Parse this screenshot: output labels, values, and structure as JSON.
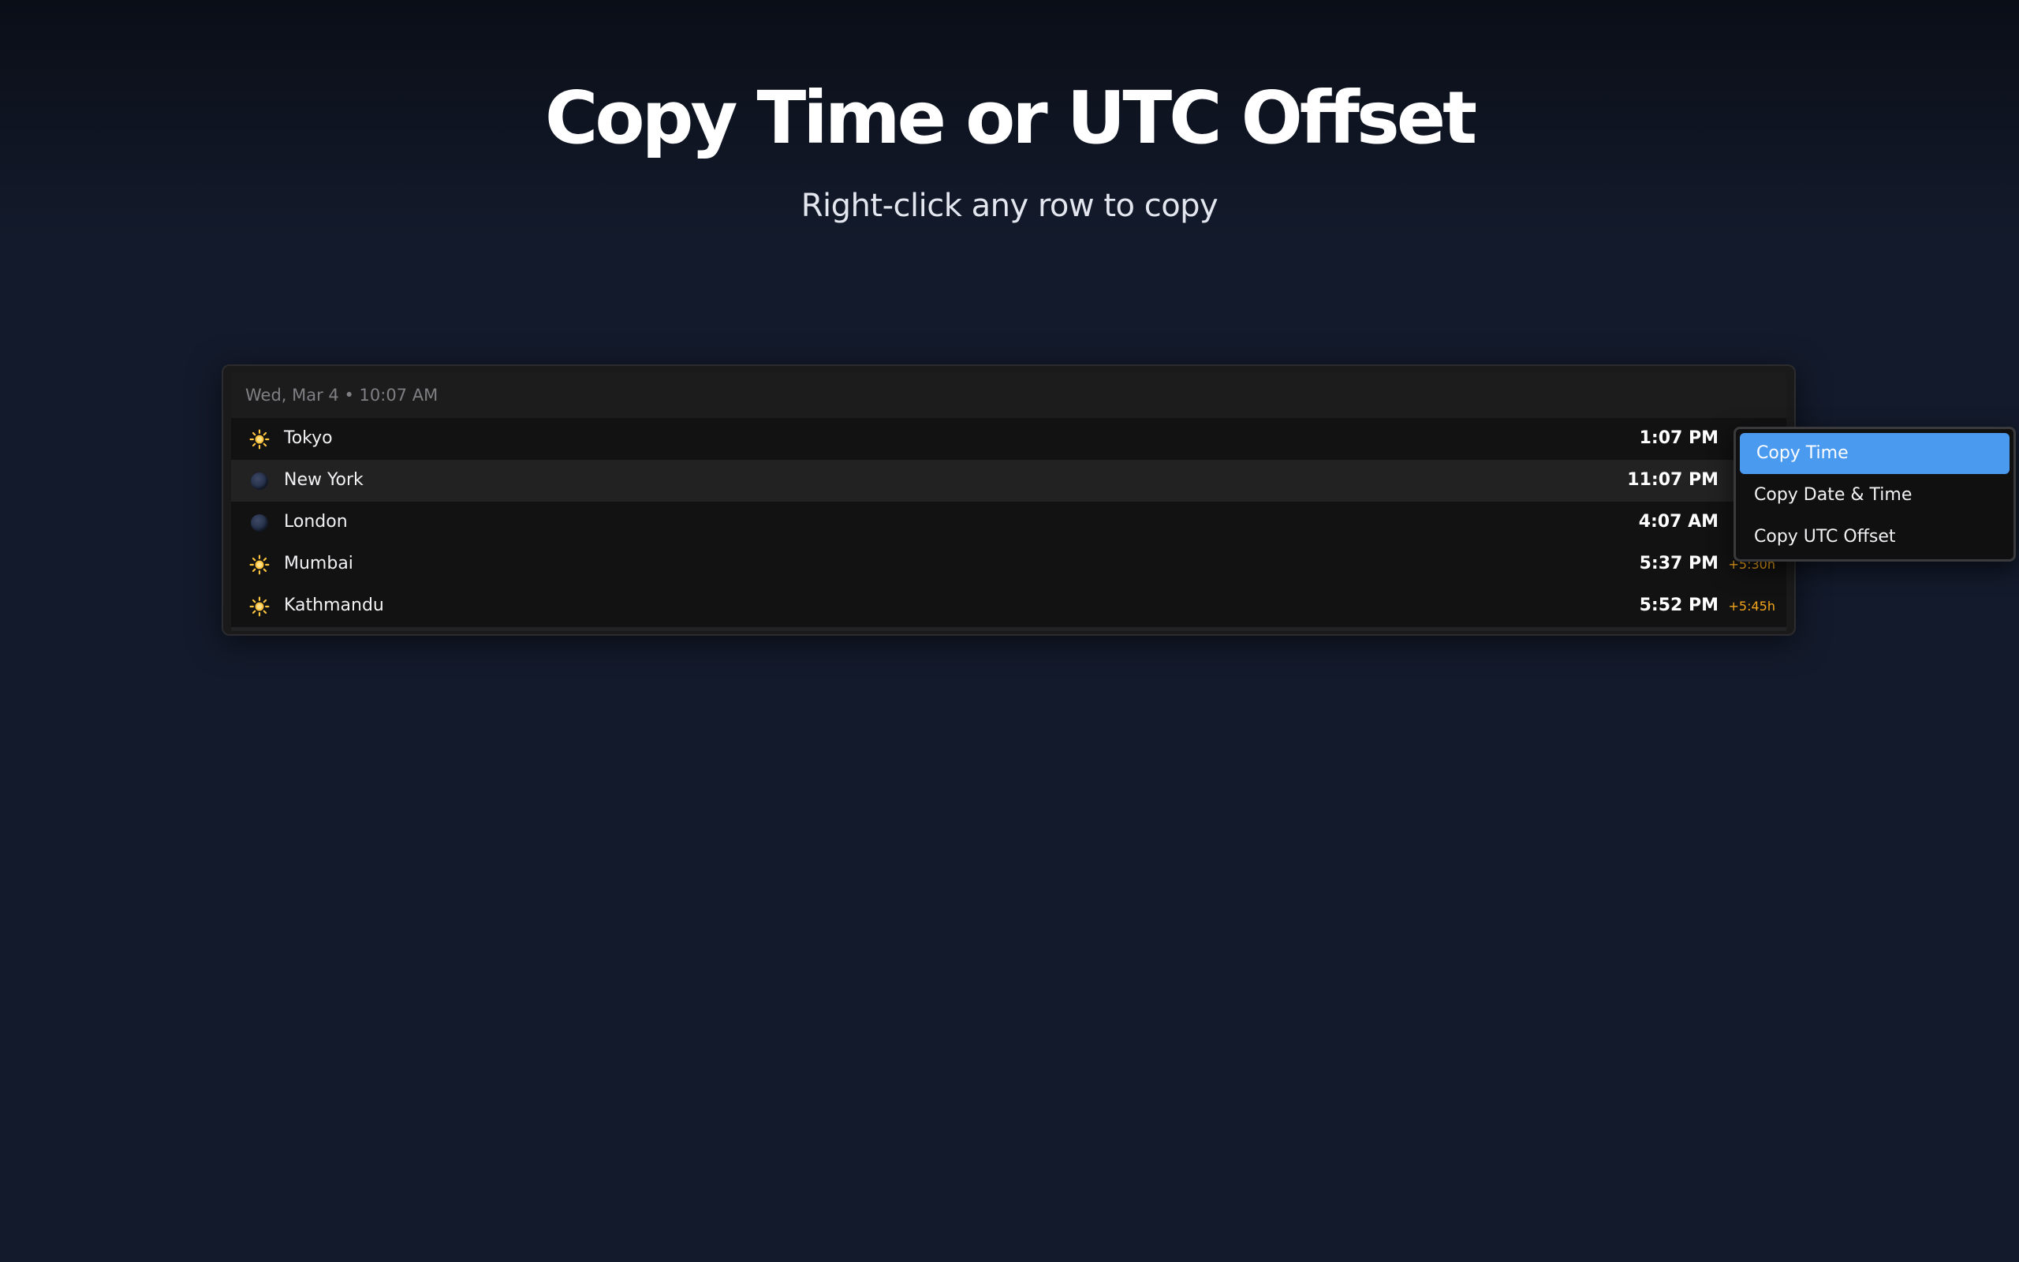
{
  "page": {
    "title": "Copy Time or UTC Offset",
    "subtitle": "Right-click any row to copy"
  },
  "panel": {
    "header_date": "Wed, Mar 4 • 10:07 AM",
    "rows": [
      {
        "icon": "sun-icon",
        "city": "Tokyo",
        "time": "1:07 PM",
        "offset": ""
      },
      {
        "icon": "moon-icon",
        "city": "New York",
        "time": "11:07 PM",
        "offset": ""
      },
      {
        "icon": "moon-icon",
        "city": "London",
        "time": "4:07 AM",
        "offset": ""
      },
      {
        "icon": "sun-icon",
        "city": "Mumbai",
        "time": "5:37 PM",
        "offset": "+5:30h"
      },
      {
        "icon": "sun-icon",
        "city": "Kathmandu",
        "time": "5:52 PM",
        "offset": "+5:45h"
      }
    ],
    "highlighted_row": "New York"
  },
  "context_menu": {
    "items": [
      {
        "label": "Copy Time",
        "active": true
      },
      {
        "label": "Copy Date & Time",
        "active": false
      },
      {
        "label": "Copy UTC Offset",
        "active": false
      }
    ]
  },
  "colors": {
    "background": "#131a2b",
    "panel": "#121213",
    "offset_accent": "#f4a51c",
    "menu_highlight": "#4a9af0",
    "sun": "#ffc53d"
  }
}
